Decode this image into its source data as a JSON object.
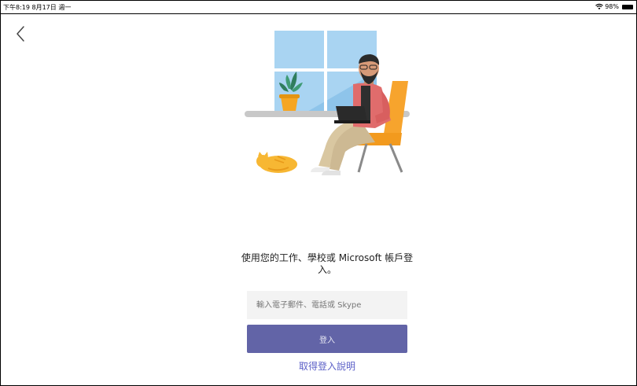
{
  "status_bar": {
    "time_date": "下午8:19  8月17日 週一",
    "battery_percent": "98%",
    "icons": [
      "wifi-icon",
      "battery-icon"
    ]
  },
  "nav": {
    "back_icon": "chevron-left-icon"
  },
  "illustration": {
    "icon": "person-with-laptop-illustration"
  },
  "signin": {
    "prompt": "使用您的工作、學校或 Microsoft 帳戶登入。",
    "input_placeholder": "輸入電子郵件、電話或 Skype",
    "input_value": "",
    "button_label": "登入",
    "help_link": "取得登入說明"
  },
  "colors": {
    "accent": "#6264a7",
    "link": "#5b5fc7",
    "input_bg": "#f3f3f3"
  }
}
